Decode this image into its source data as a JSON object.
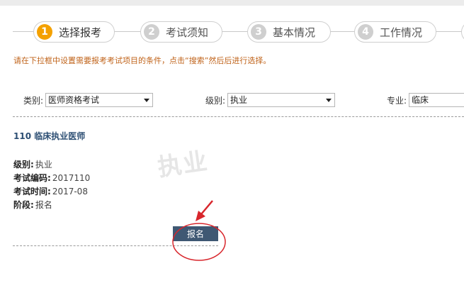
{
  "steps": [
    {
      "num": "1",
      "label": "选择报考"
    },
    {
      "num": "2",
      "label": "考试须知"
    },
    {
      "num": "3",
      "label": "基本情况"
    },
    {
      "num": "4",
      "label": "工作情况"
    }
  ],
  "hint": "请在下拉框中设置需要报考考试项目的条件，点击“搜索”然后后进行选择。",
  "filters": {
    "category": {
      "label": "类别:",
      "value": "医师资格考试"
    },
    "level": {
      "label": "级别:",
      "value": "执业"
    },
    "major": {
      "label": "专业:",
      "value": "临床"
    }
  },
  "exam": {
    "title": "110 临床执业医师",
    "fields": [
      {
        "key": "级别:",
        "value": "执业"
      },
      {
        "key": "考试编码:",
        "value": "2017110"
      },
      {
        "key": "考试时间:",
        "value": "2017-08"
      },
      {
        "key": "阶段:",
        "value": "报名"
      }
    ]
  },
  "watermark": "执业",
  "signup_button": "报名",
  "colors": {
    "active_step": "#f4a100",
    "hint": "#c0631a",
    "button": "#3f5873",
    "annotation": "#d8262c"
  }
}
